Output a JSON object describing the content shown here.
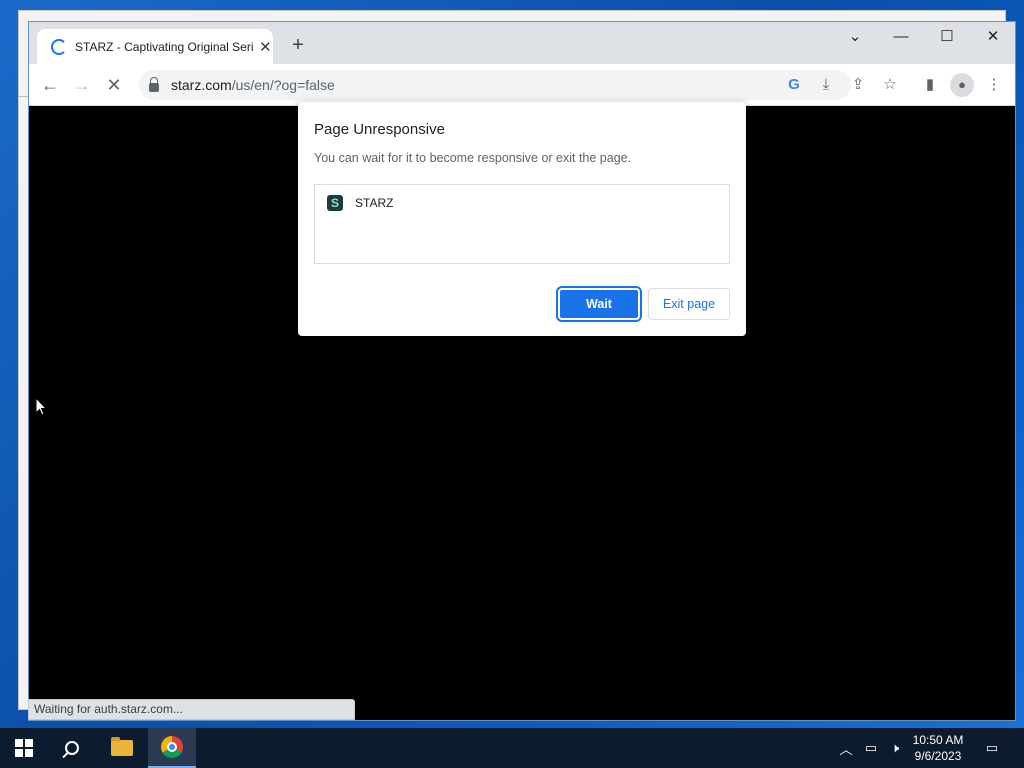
{
  "browser": {
    "tab_title": "STARZ - Captivating Original Series",
    "tab_close": "✕",
    "new_tab": "+",
    "url_host": "starz.com",
    "url_path": "/us/en/?og=false",
    "window_controls": {
      "menu": "⌄",
      "minimize": "—",
      "maximize": "☐",
      "close": "✕"
    }
  },
  "toolbar": {
    "back": "←",
    "forward": "→",
    "reload": "✕"
  },
  "dialog": {
    "heading": "Page Unresponsive",
    "message": "You can wait for it to become responsive or exit the page.",
    "item_logo": "S",
    "item_name": "STARZ",
    "wait_label": "Wait",
    "exit_label": "Exit page"
  },
  "status_bar": {
    "text": "Waiting for auth.starz.com..."
  },
  "taskbar": {
    "time": "10:50 AM",
    "date": "9/6/2023"
  },
  "colors": {
    "accent": "#1a73e8",
    "desktop": "#0b5cc0",
    "taskbar": "#0d1b2e"
  }
}
